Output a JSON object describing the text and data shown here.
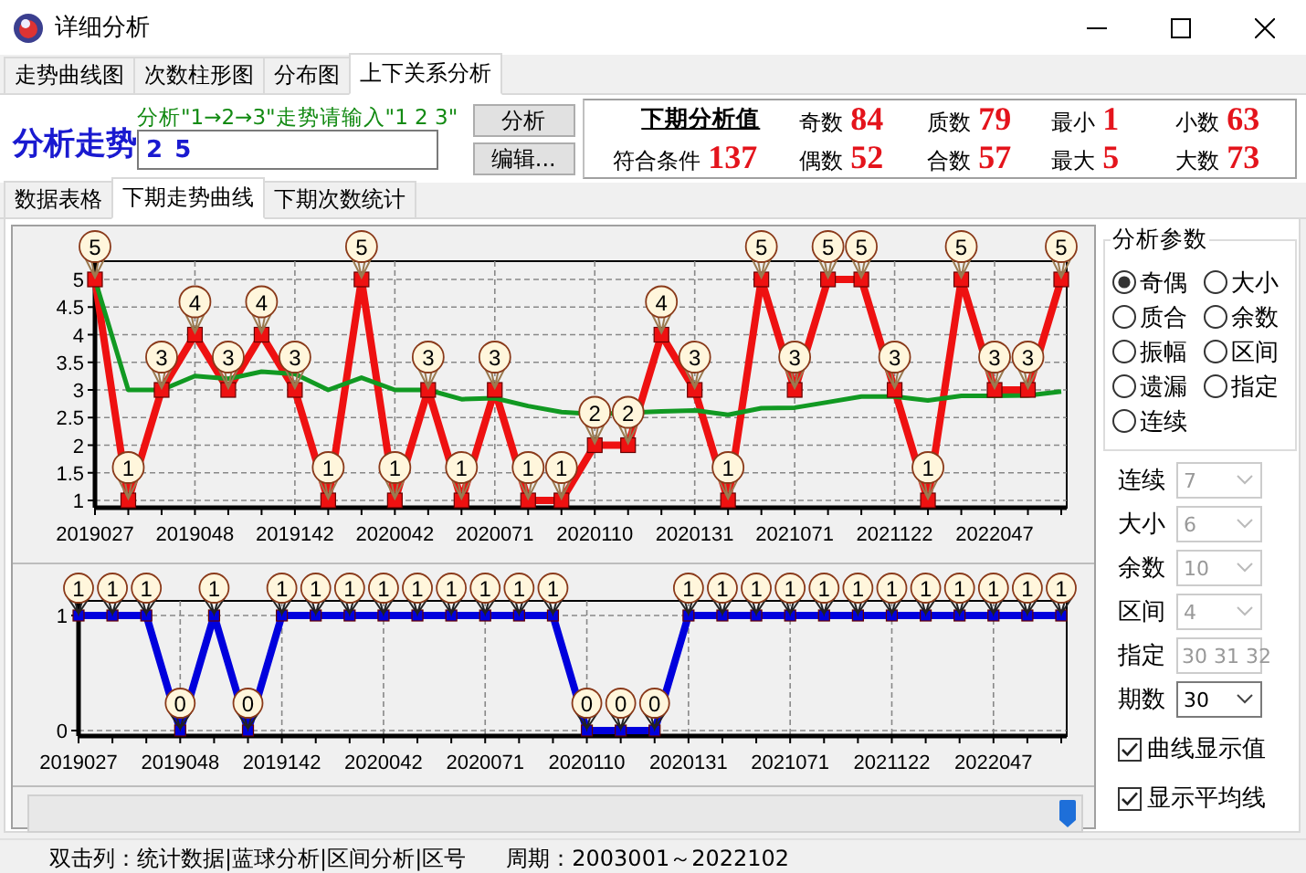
{
  "window": {
    "title": "详细分析"
  },
  "tabs": [
    {
      "label": "走势曲线图",
      "selected": false
    },
    {
      "label": "次数柱形图",
      "selected": false
    },
    {
      "label": "分布图",
      "selected": false
    },
    {
      "label": "上下关系分析",
      "selected": true
    }
  ],
  "analysis": {
    "label": "分析走势",
    "hint": "分析\"1→2→3\"走势请输入\"1 2 3\"",
    "value": "2 5",
    "buttons": [
      "分析",
      "编辑..."
    ]
  },
  "summary": {
    "heading": "下期分析值",
    "matching": {
      "label": "符合条件",
      "value": "137"
    },
    "stats": [
      {
        "label": "奇数",
        "value": "84"
      },
      {
        "label": "偶数",
        "value": "52"
      },
      {
        "label": "质数",
        "value": "79"
      },
      {
        "label": "合数",
        "value": "57"
      },
      {
        "label": "最小",
        "value": "1"
      },
      {
        "label": "最大",
        "value": "5"
      },
      {
        "label": "小数",
        "value": "63"
      },
      {
        "label": "大数",
        "value": "73"
      }
    ]
  },
  "subtabs": [
    {
      "label": "数据表格",
      "selected": false
    },
    {
      "label": "下期走势曲线",
      "selected": true
    },
    {
      "label": "下期次数统计",
      "selected": false
    }
  ],
  "trend_chart": {
    "chart_data": {
      "type": "line",
      "grid": true,
      "ylim": [
        1,
        5
      ],
      "yticks": [
        {
          "value": 1,
          "label": "1"
        },
        {
          "value": 1.5,
          "label": "1.5"
        },
        {
          "value": 2,
          "label": "2"
        },
        {
          "value": 2.5,
          "label": "2.5"
        },
        {
          "value": 3,
          "label": "3"
        },
        {
          "value": 3.5,
          "label": "3.5"
        },
        {
          "value": 4,
          "label": "4"
        },
        {
          "value": 4.5,
          "label": "4.5"
        },
        {
          "value": 5,
          "label": "5"
        }
      ],
      "categories": [
        "2019027",
        null,
        null,
        "2019048",
        null,
        null,
        "2019142",
        null,
        null,
        "2020042",
        null,
        null,
        "2020071",
        null,
        null,
        "2020110",
        null,
        null,
        "2020131",
        null,
        null,
        "2021071",
        null,
        null,
        "2021122",
        null,
        null,
        "2022047",
        null,
        null
      ],
      "series": [
        {
          "color": "#ee1111",
          "marker": "square",
          "value_labels": [
            "5",
            "1",
            "3",
            "4",
            "3",
            "4",
            "3",
            "1",
            "5",
            "1",
            "3",
            "1",
            "3",
            "1",
            "1",
            "2",
            "2",
            "4",
            "3",
            "1",
            "5",
            "3",
            "5",
            "5",
            "3",
            "1",
            "5",
            "3",
            "3",
            "5"
          ],
          "values": [
            5,
            1,
            3,
            4,
            3,
            4,
            3,
            1,
            5,
            1,
            3,
            1,
            3,
            1,
            1,
            2,
            2,
            4,
            3,
            1,
            5,
            3,
            5,
            5,
            3,
            1,
            5,
            3,
            3,
            5
          ]
        },
        {
          "color": "#119922",
          "values": [
            5,
            3,
            3,
            3.25,
            3.2,
            3.33,
            3.29,
            3,
            3.22,
            3,
            3,
            2.83,
            2.85,
            2.71,
            2.6,
            2.56,
            null,
            2.61,
            2.63,
            2.55,
            2.67,
            2.68,
            2.78,
            2.88,
            2.88,
            2.81,
            2.89,
            2.89,
            2.9,
            2.97
          ]
        }
      ]
    }
  },
  "parity_chart": {
    "chart_data": {
      "type": "line",
      "grid": true,
      "ylim": [
        0,
        1
      ],
      "yticks": [
        {
          "value": 0,
          "label": "0"
        },
        {
          "value": 1,
          "label": "1"
        }
      ],
      "categories": [
        "2019027",
        null,
        null,
        "2019048",
        null,
        null,
        "2019142",
        null,
        null,
        "2020042",
        null,
        null,
        "2020071",
        null,
        null,
        "2020110",
        null,
        null,
        "2020131",
        null,
        null,
        "2021071",
        null,
        null,
        "2021122",
        null,
        null,
        "2022047",
        null,
        null
      ],
      "series": [
        {
          "color": "#0000dd",
          "marker": "square",
          "value_labels": [
            "1",
            "1",
            "1",
            "0",
            "1",
            "0",
            "1",
            "1",
            "1",
            "1",
            "1",
            "1",
            "1",
            "1",
            "1",
            "0",
            "0",
            "0",
            "1",
            "1",
            "1",
            "1",
            "1",
            "1",
            "1",
            "1",
            "1",
            "1",
            "1",
            "1"
          ],
          "values": [
            1,
            1,
            1,
            0,
            1,
            0,
            1,
            1,
            1,
            1,
            1,
            1,
            1,
            1,
            1,
            0,
            0,
            0,
            1,
            1,
            1,
            1,
            1,
            1,
            1,
            1,
            1,
            1,
            1,
            1
          ]
        }
      ]
    }
  },
  "params": {
    "title": "分析参数",
    "options": [
      {
        "label": "奇偶",
        "selected": true
      },
      {
        "label": "大小",
        "selected": false
      },
      {
        "label": "质合",
        "selected": false
      },
      {
        "label": "余数",
        "selected": false
      },
      {
        "label": "振幅",
        "selected": false
      },
      {
        "label": "区间",
        "selected": false
      },
      {
        "label": "遗漏",
        "selected": false
      },
      {
        "label": "指定",
        "selected": false
      },
      {
        "label": "连续",
        "selected": false
      }
    ]
  },
  "fields": [
    {
      "kind": "combo",
      "label": "连续",
      "value": "7",
      "disabled": true
    },
    {
      "kind": "combo",
      "label": "大小",
      "value": "6",
      "disabled": true
    },
    {
      "kind": "combo",
      "label": "余数",
      "value": "10",
      "disabled": true
    },
    {
      "kind": "combo",
      "label": "区间",
      "value": "4",
      "disabled": true
    },
    {
      "kind": "text",
      "label": "指定",
      "value": "30 31 32",
      "disabled": true
    },
    {
      "kind": "combo",
      "label": "期数",
      "value": "30",
      "disabled": false
    }
  ],
  "checkboxes": [
    {
      "label": "曲线显示值",
      "checked": true
    },
    {
      "label": "显示平均线",
      "checked": true
    }
  ],
  "status_bar": [
    "双击列：统计数据|蓝球分析|区间分析|区号",
    "周期：2003001～2022102"
  ]
}
